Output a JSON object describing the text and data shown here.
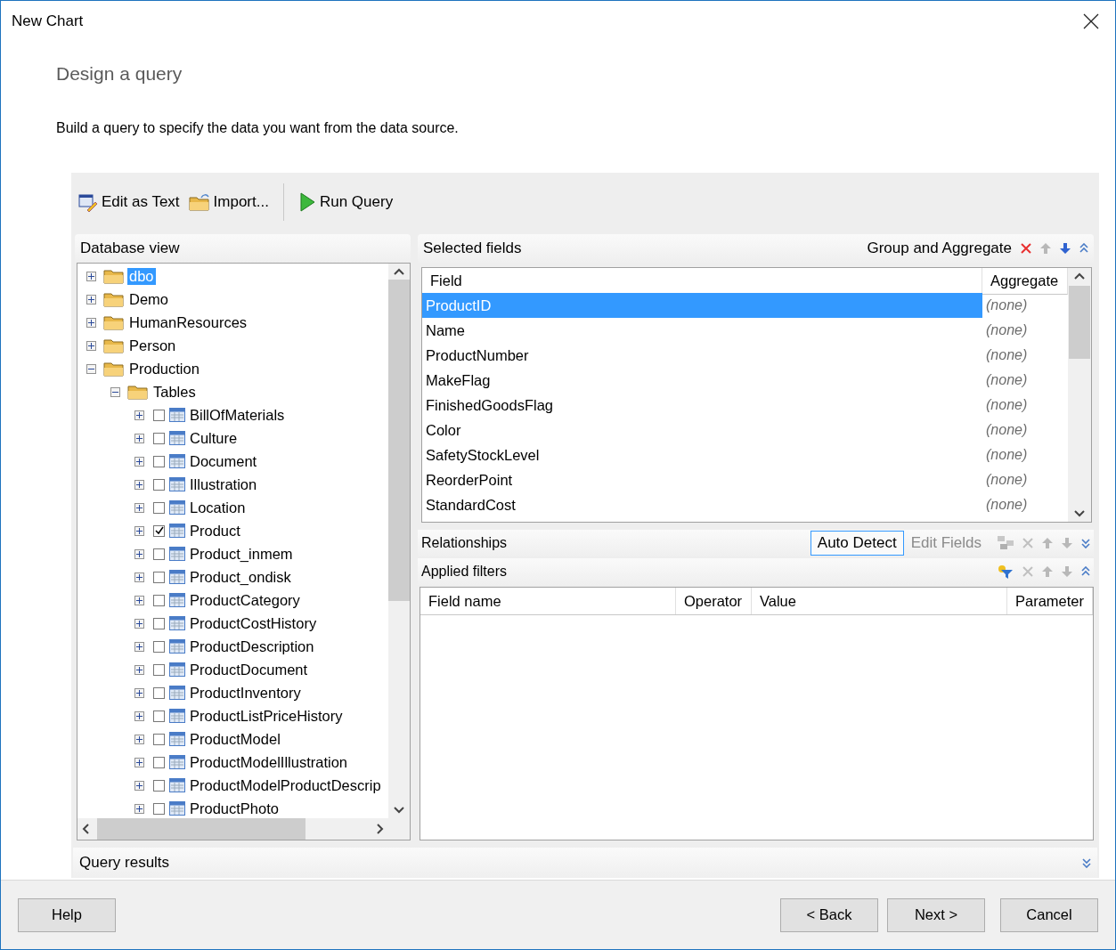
{
  "window": {
    "title": "New Chart"
  },
  "heading": "Design a query",
  "description": "Build a query to specify the data you want from the data source.",
  "toolbar": [
    {
      "label": "Edit as Text",
      "kind": "edit"
    },
    {
      "label": "Import...",
      "kind": "import"
    },
    {
      "label": "Run Query",
      "kind": "run"
    }
  ],
  "database_view": {
    "title": "Database view",
    "tree": [
      {
        "label": "dbo",
        "kind": "folder",
        "expanded": false,
        "selected": true
      },
      {
        "label": "Demo",
        "kind": "folder",
        "expanded": false,
        "selected": false
      },
      {
        "label": "HumanResources",
        "kind": "folder",
        "expanded": false,
        "selected": false
      },
      {
        "label": "Person",
        "kind": "folder",
        "expanded": false,
        "selected": false
      },
      {
        "label": "Production",
        "kind": "folder",
        "expanded": true,
        "selected": false,
        "children": [
          {
            "label": "Tables",
            "kind": "folder",
            "expanded": true,
            "selected": false,
            "children": [
              {
                "label": "BillOfMaterials",
                "kind": "table",
                "expanded": false,
                "selected": false,
                "checked": false
              },
              {
                "label": "Culture",
                "kind": "table",
                "expanded": false,
                "selected": false,
                "checked": false
              },
              {
                "label": "Document",
                "kind": "table",
                "expanded": false,
                "selected": false,
                "checked": false
              },
              {
                "label": "Illustration",
                "kind": "table",
                "expanded": false,
                "selected": false,
                "checked": false
              },
              {
                "label": "Location",
                "kind": "table",
                "expanded": false,
                "selected": false,
                "checked": false
              },
              {
                "label": "Product",
                "kind": "table",
                "expanded": false,
                "selected": false,
                "checked": true
              },
              {
                "label": "Product_inmem",
                "kind": "table",
                "expanded": false,
                "selected": false,
                "checked": false
              },
              {
                "label": "Product_ondisk",
                "kind": "table",
                "expanded": false,
                "selected": false,
                "checked": false
              },
              {
                "label": "ProductCategory",
                "kind": "table",
                "expanded": false,
                "selected": false,
                "checked": false
              },
              {
                "label": "ProductCostHistory",
                "kind": "table",
                "expanded": false,
                "selected": false,
                "checked": false
              },
              {
                "label": "ProductDescription",
                "kind": "table",
                "expanded": false,
                "selected": false,
                "checked": false
              },
              {
                "label": "ProductDocument",
                "kind": "table",
                "expanded": false,
                "selected": false,
                "checked": false
              },
              {
                "label": "ProductInventory",
                "kind": "table",
                "expanded": false,
                "selected": false,
                "checked": false
              },
              {
                "label": "ProductListPriceHistory",
                "kind": "table",
                "expanded": false,
                "selected": false,
                "checked": false
              },
              {
                "label": "ProductModel",
                "kind": "table",
                "expanded": false,
                "selected": false,
                "checked": false
              },
              {
                "label": "ProductModelIllustration",
                "kind": "table",
                "expanded": false,
                "selected": false,
                "checked": false
              },
              {
                "label": "ProductModelProductDescrip",
                "kind": "table",
                "expanded": false,
                "selected": false,
                "checked": false
              },
              {
                "label": "ProductPhoto",
                "kind": "table",
                "expanded": false,
                "selected": false,
                "checked": false
              }
            ]
          }
        ]
      }
    ]
  },
  "selected_fields": {
    "title": "Selected fields",
    "group_label": "Group and Aggregate",
    "columns": [
      "Field",
      "Aggregate"
    ],
    "rows": [
      {
        "field": "ProductID",
        "aggregate": "(none)",
        "selected": true
      },
      {
        "field": "Name",
        "aggregate": "(none)",
        "selected": false
      },
      {
        "field": "ProductNumber",
        "aggregate": "(none)",
        "selected": false
      },
      {
        "field": "MakeFlag",
        "aggregate": "(none)",
        "selected": false
      },
      {
        "field": "FinishedGoodsFlag",
        "aggregate": "(none)",
        "selected": false
      },
      {
        "field": "Color",
        "aggregate": "(none)",
        "selected": false
      },
      {
        "field": "SafetyStockLevel",
        "aggregate": "(none)",
        "selected": false
      },
      {
        "field": "ReorderPoint",
        "aggregate": "(none)",
        "selected": false
      },
      {
        "field": "StandardCost",
        "aggregate": "(none)",
        "selected": false
      }
    ]
  },
  "relationships": {
    "title": "Relationships",
    "buttons": [
      {
        "label": "Auto Detect",
        "disabled": false
      },
      {
        "label": "Edit Fields",
        "disabled": true
      }
    ]
  },
  "applied_filters": {
    "title": "Applied filters",
    "columns": [
      "Field name",
      "Operator",
      "Value",
      "Parameter"
    ]
  },
  "query_results": {
    "title": "Query results"
  },
  "buttons": [
    {
      "label": "Help"
    },
    {
      "label": "< Back"
    },
    {
      "label": "Next >"
    },
    {
      "label": "Cancel"
    }
  ]
}
